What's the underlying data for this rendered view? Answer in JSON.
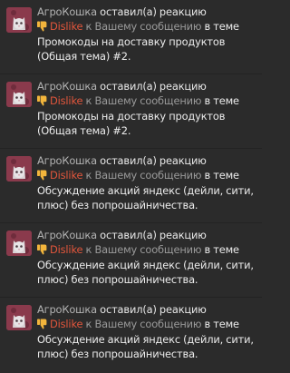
{
  "alerts": [
    {
      "username": "АгроКошка",
      "action": "оставил(а) реакцию",
      "reaction": "Dislike",
      "connector": "к",
      "target": "Вашему сообщению",
      "in_thread": "в теме",
      "thread_title": "Промокоды на доставку продуктов (Общая тема) #2."
    },
    {
      "username": "АгроКошка",
      "action": "оставил(а) реакцию",
      "reaction": "Dislike",
      "connector": "к",
      "target": "Вашему сообщению",
      "in_thread": "в теме",
      "thread_title": "Промокоды на доставку продуктов (Общая тема) #2."
    },
    {
      "username": "АгроКошка",
      "action": "оставил(а) реакцию",
      "reaction": "Dislike",
      "connector": "к",
      "target": "Вашему сообщению",
      "in_thread": "в теме",
      "thread_title": "Обсуждение акций яндекс (дейли, сити, плюс) без попрошайничества."
    },
    {
      "username": "АгроКошка",
      "action": "оставил(а) реакцию",
      "reaction": "Dislike",
      "connector": "к",
      "target": "Вашему сообщению",
      "in_thread": "в теме",
      "thread_title": "Обсуждение акций яндекс (дейли, сити, плюс) без попрошайничества."
    },
    {
      "username": "АгроКошка",
      "action": "оставил(а) реакцию",
      "reaction": "Dislike",
      "connector": "к",
      "target": "Вашему сообщению",
      "in_thread": "в теме",
      "thread_title": "Обсуждение акций яндекс (дейли, сити, плюс) без попрошайничества."
    }
  ],
  "colors": {
    "background": "#2b2b2b",
    "reaction": "#e2563c",
    "thumb": "#f2b53c",
    "avatar": "#8a3a4c"
  },
  "icons": {
    "reaction": "thumbs-down-icon",
    "avatar": "cat-avatar-icon"
  }
}
